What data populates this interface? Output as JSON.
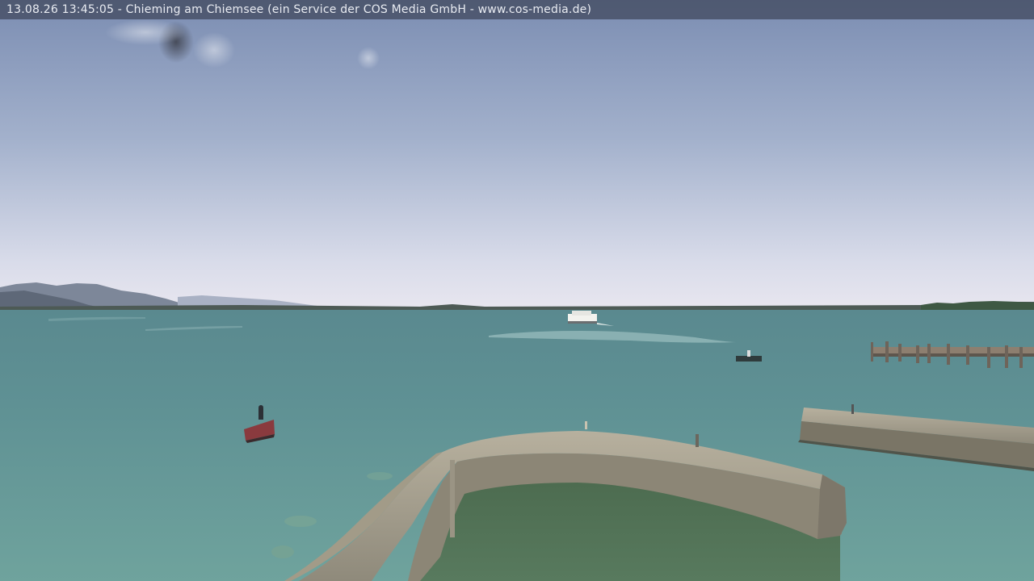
{
  "overlay": {
    "caption": "13.08.26 13:45:05 - Chieming am Chiemsee (ein Service der COS Media GmbH - www.cos-media.de)"
  },
  "colors": {
    "sky_top": "#7d8fb3",
    "sky_bottom": "#e4e4ef",
    "water_far": "#5f8f93",
    "water_near": "#6b9c98",
    "wall": "#9c9686",
    "harbor_water": "#4d6f55",
    "caption_bar": "#464e64",
    "caption_text": "#e9ecf2"
  }
}
